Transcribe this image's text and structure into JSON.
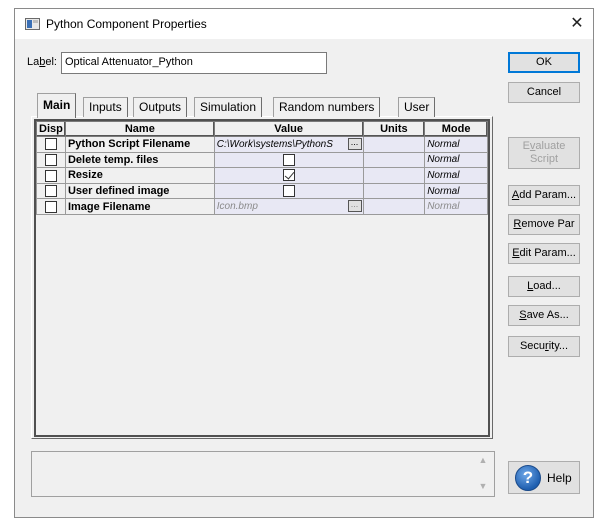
{
  "window": {
    "title": "Python Component Properties",
    "close_glyph": "✕"
  },
  "label_field": {
    "caption_pre": "La",
    "caption_u": "b",
    "caption_post": "el:",
    "value": "Optical Attenuator_Python"
  },
  "tabs": [
    "Main",
    "Inputs",
    "Outputs",
    "Simulation",
    "Random numbers",
    "User"
  ],
  "table": {
    "headers": [
      "Disp",
      "Name",
      "Value",
      "Units",
      "Mode"
    ],
    "rows": [
      {
        "disp": false,
        "name": "Python Script Filename",
        "value_type": "text",
        "value": "C:\\Work\\systems\\PythonS",
        "has_browse": true,
        "units": "",
        "mode": "Normal",
        "disabled": false
      },
      {
        "disp": false,
        "name": "Delete temp. files",
        "value_type": "checkbox",
        "checked": false,
        "units": "",
        "mode": "Normal",
        "disabled": false
      },
      {
        "disp": false,
        "name": "Resize",
        "value_type": "checkbox",
        "checked": true,
        "units": "",
        "mode": "Normal",
        "disabled": false
      },
      {
        "disp": false,
        "name": "User defined image",
        "value_type": "checkbox",
        "checked": false,
        "units": "",
        "mode": "Normal",
        "disabled": false
      },
      {
        "disp": false,
        "name": "Image Filename",
        "value_type": "text",
        "value": "Icon.bmp",
        "has_browse": true,
        "units": "",
        "mode": "Normal",
        "disabled": true
      }
    ],
    "browse_glyph": "..."
  },
  "buttons": {
    "ok": "OK",
    "cancel": "Cancel",
    "evaluate_pre": "E",
    "evaluate_u": "v",
    "evaluate_post": "aluate",
    "evaluate_line2": "Script",
    "add_param_u": "A",
    "add_param_post": "dd Param...",
    "remove_par_u": "R",
    "remove_par_post": "emove Par",
    "edit_param_u": "E",
    "edit_param_post": "dit Param...",
    "load_u": "L",
    "load_post": "oad...",
    "save_as_u": "S",
    "save_as_post": "ave As...",
    "security_pre": "Secu",
    "security_u": "r",
    "security_post": "ity...",
    "help": "Help",
    "help_glyph": "?"
  },
  "scroll": {
    "up_glyph": "▲",
    "down_glyph": "▼"
  },
  "icons": [
    "window-icon",
    "close-icon",
    "checkbox-icon",
    "browse-icon",
    "help-icon",
    "scroll-up-icon",
    "scroll-down-icon"
  ]
}
